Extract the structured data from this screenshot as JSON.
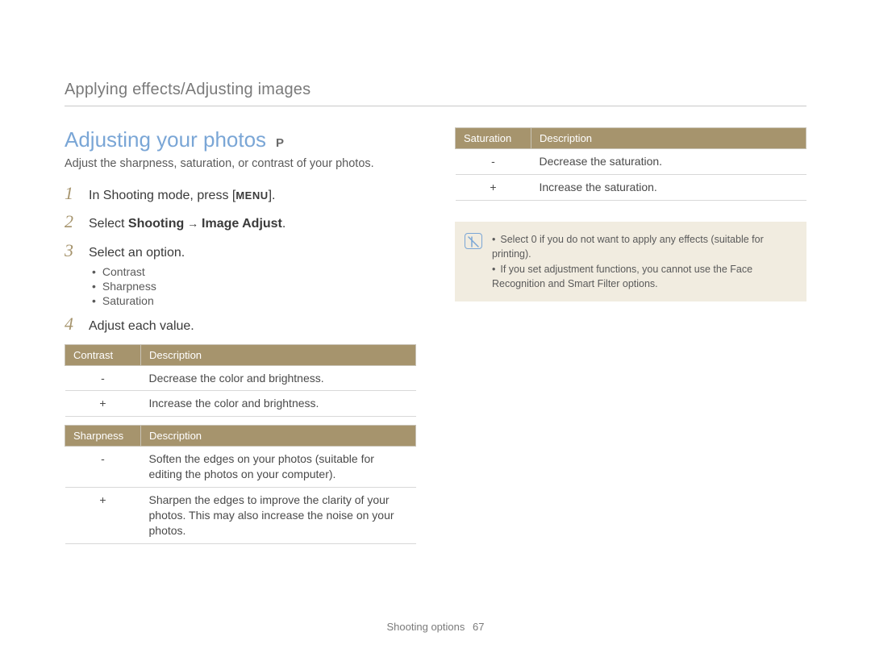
{
  "breadcrumb": "Applying effects/Adjusting images",
  "section": {
    "title": "Adjusting your photos",
    "mode": "P",
    "subtitle": "Adjust the sharpness, saturation, or contrast of your photos."
  },
  "steps": {
    "s1_pre": "In Shooting mode, press [",
    "s1_key": "MENU",
    "s1_post": "].",
    "s2_pre": "Select ",
    "s2_b1": "Shooting",
    "s2_arrow": " → ",
    "s2_b2": "Image Adjust",
    "s2_post": ".",
    "s3": "Select an option.",
    "s4": "Adjust each value."
  },
  "options": [
    "Contrast",
    "Sharpness",
    "Saturation"
  ],
  "tables": {
    "contrast": {
      "h1": "Contrast",
      "h2": "Description",
      "rows": [
        {
          "k": "-",
          "v": "Decrease the color and brightness."
        },
        {
          "k": "+",
          "v": "Increase the color and brightness."
        }
      ]
    },
    "sharpness": {
      "h1": "Sharpness",
      "h2": "Description",
      "rows": [
        {
          "k": "-",
          "v": "Soften the edges on your photos (suitable for editing the photos on your computer)."
        },
        {
          "k": "+",
          "v": "Sharpen the edges to improve the clarity of your photos. This may also increase the noise on your photos."
        }
      ]
    },
    "saturation": {
      "h1": "Saturation",
      "h2": "Description",
      "rows": [
        {
          "k": "-",
          "v": "Decrease the saturation."
        },
        {
          "k": "+",
          "v": "Increase the saturation."
        }
      ]
    }
  },
  "note": {
    "n1": "Select 0 if you do not want to apply any effects (suitable for printing).",
    "n2": "If you set adjustment functions, you cannot use the Face Recognition and Smart Filter options."
  },
  "footer": {
    "section": "Shooting options",
    "page": "67"
  }
}
